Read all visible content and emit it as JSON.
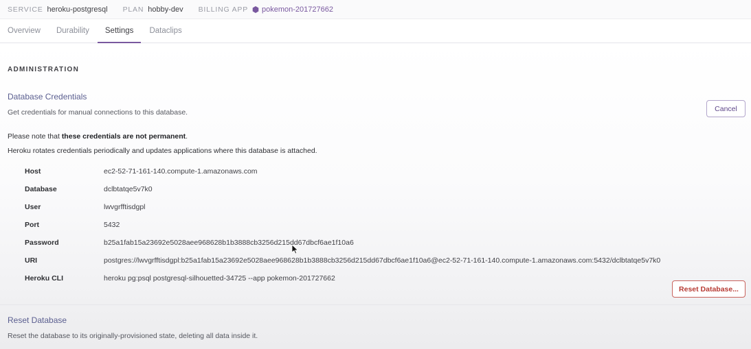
{
  "header": {
    "service_key": "SERVICE",
    "service_value": "heroku-postgresql",
    "plan_key": "PLAN",
    "plan_value": "hobby-dev",
    "billing_key": "BILLING APP",
    "billing_value": "pokemon-201727662",
    "billing_icon": "hexagon-icon",
    "accent_color": "#79589f"
  },
  "tabs": [
    {
      "label": "Overview",
      "active": false
    },
    {
      "label": "Durability",
      "active": false
    },
    {
      "label": "Settings",
      "active": true
    },
    {
      "label": "Dataclips",
      "active": false
    }
  ],
  "administration": {
    "heading": "ADMINISTRATION",
    "credentials": {
      "title": "Database Credentials",
      "description": "Get credentials for manual connections to this database.",
      "cancel_label": "Cancel",
      "note_prefix": "Please note that ",
      "note_bold": "these credentials are not permanent",
      "note_suffix": ".",
      "rotation_note": "Heroku rotates credentials periodically and updates applications where this database is attached.",
      "rows": [
        {
          "label": "Host",
          "value": "ec2-52-71-161-140.compute-1.amazonaws.com"
        },
        {
          "label": "Database",
          "value": "dclbtatqe5v7k0"
        },
        {
          "label": "User",
          "value": "lwvgrfftisdgpl"
        },
        {
          "label": "Port",
          "value": "5432"
        },
        {
          "label": "Password",
          "value": "b25a1fab15a23692e5028aee968628b1b3888cb3256d215dd67dbcf6ae1f10a6"
        },
        {
          "label": "URI",
          "value": "postgres://lwvgrfftisdgpl:b25a1fab15a23692e5028aee968628b1b3888cb3256d215dd67dbcf6ae1f10a6@ec2-52-71-161-140.compute-1.amazonaws.com:5432/dclbtatqe5v7k0"
        },
        {
          "label": "Heroku CLI",
          "value": "heroku pg:psql postgresql-silhouetted-34725 --app pokemon-201727662"
        }
      ]
    },
    "reset": {
      "title": "Reset Database",
      "description": "Reset the database to its originally-provisioned state, deleting all data inside it.",
      "button_label": "Reset Database..."
    }
  }
}
